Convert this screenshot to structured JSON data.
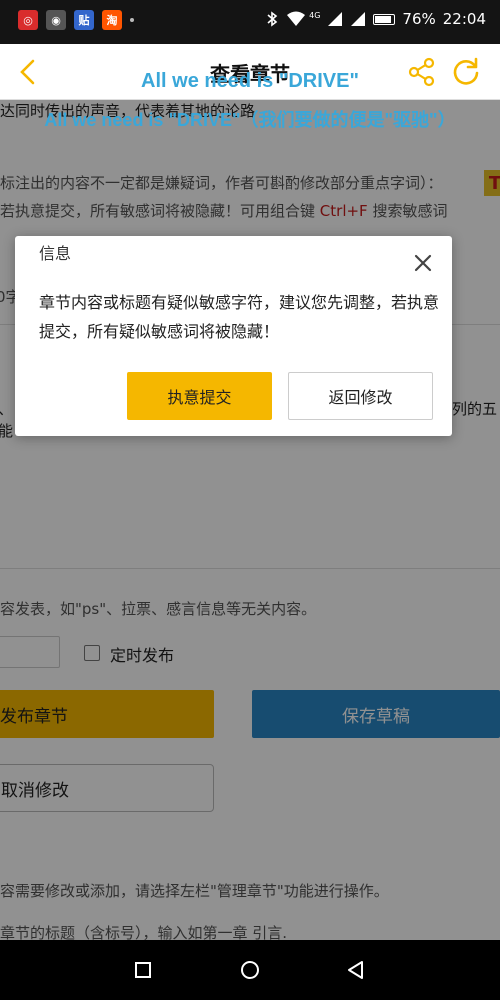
{
  "status_bar": {
    "apps": [
      {
        "icon": "netease-music-icon",
        "glyph": "◎",
        "color": "#d92c2c"
      },
      {
        "icon": "chat-icon",
        "glyph": "◉",
        "color": "#555555"
      },
      {
        "icon": "tieba-icon",
        "glyph": "贴",
        "color": "#3366cc"
      },
      {
        "icon": "taobao-icon",
        "glyph": "淘",
        "color": "#ff5500"
      }
    ],
    "network_label": "4G",
    "battery_text": "76%",
    "battery_level": 0.76,
    "time": "22:04"
  },
  "header": {
    "title": "查看章节",
    "back_icon": "chevron-left-icon",
    "share_icon": "share-icon",
    "refresh_icon": "refresh-icon",
    "accent_color": "#f5b700"
  },
  "overlay": {
    "line1": "All we need is \"DRIVE\"",
    "line2": "All we need is \"DRIVE\"（我们要做的便是\"驱驰\"）"
  },
  "background": {
    "lines": [
      "达同时传出的声音，代表着其地的论路",
      "标注出的内容不一定都是嫌疑词，作者可斟酌修改部分重点字词）：",
      "若执意提交，所有敏感词将被隐藏！可用组合键",
      "Ctrl+F",
      "搜索敏感词",
      "0字",
      "、",
      "能",
      "列的五",
      "容发表，如\"ps\"、拉票、感言信息等无关内容。",
      "定时发布",
      "容需要修改或添加，请选择左栏\"管理章节\"功能进行操作。",
      "章节的标题（含标号），输入如第一章 引言."
    ],
    "corner_badge": "T",
    "publish_label": "发布章节",
    "draft_label": "保存草稿",
    "cancel_label": "取消修改"
  },
  "dialog": {
    "title": "信息",
    "message": "章节内容或标题有疑似敏感字符，建议您先调整，若执意提交，所有疑似敏感词将被隐藏！",
    "confirm_label": "执意提交",
    "return_label": "返回修改"
  },
  "nav": {
    "recent_icon": "square-icon",
    "home_icon": "circle-icon",
    "back_icon": "triangle-back-icon"
  }
}
